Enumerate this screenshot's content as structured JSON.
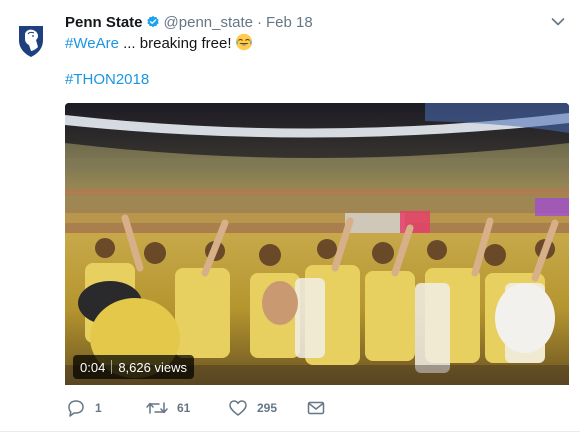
{
  "tweet": {
    "display_name": "Penn State",
    "verified": true,
    "handle": "@penn_state",
    "separator": "·",
    "date": "Feb 18",
    "text_hashtag": "#WeAre",
    "text_body": " ... breaking free!",
    "emoji": "face-with-tears-of-joy",
    "hashtag_line": "#THON2018",
    "video": {
      "time": "0:04",
      "views": "8,626 views"
    },
    "actions": {
      "replies": "1",
      "retweets": "61",
      "likes": "295"
    }
  },
  "icons": {
    "avatar": "penn-state-nittany-lion-shield",
    "verified": "verified-badge-icon",
    "caret": "chevron-down-icon",
    "reply": "reply-icon",
    "retweet": "retweet-icon",
    "like": "heart-icon",
    "dm": "envelope-icon"
  },
  "colors": {
    "link": "#1b95e0",
    "secondary_text": "#657786",
    "verified": "#1da1f2",
    "brand_navy": "#1e407c"
  }
}
